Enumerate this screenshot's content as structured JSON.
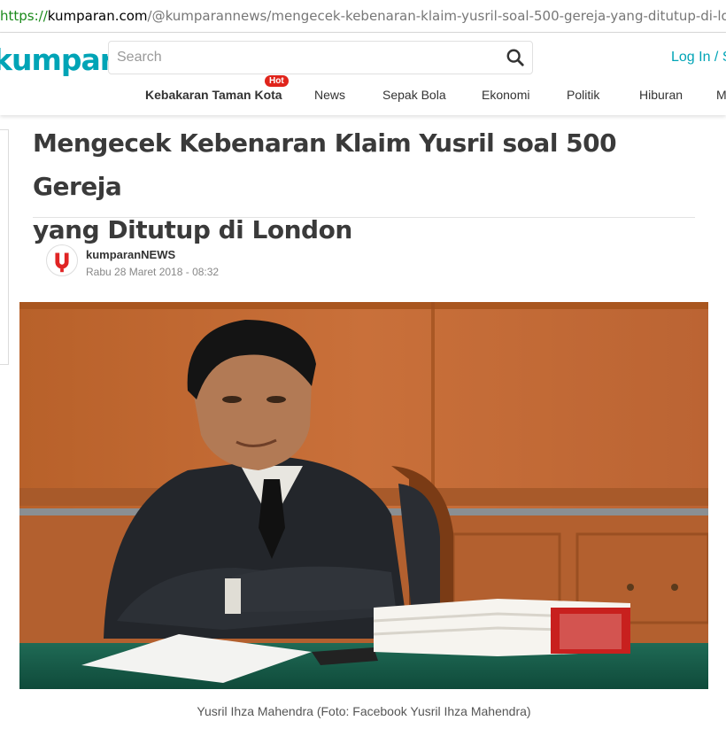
{
  "browser": {
    "url_scheme": "https://",
    "url_host": "kumparan.com",
    "url_path": "/@kumparannews/mengecek-kebenaran-klaim-yusril-soal-500-gereja-yang-ditutup-di-london"
  },
  "header": {
    "logo_text": "kumparan",
    "search_placeholder": "Search",
    "login_text": "Log In / S",
    "nav": [
      {
        "label": "Kebakaran Taman Kota",
        "badge": "Hot"
      },
      {
        "label": "News"
      },
      {
        "label": "Sepak Bola"
      },
      {
        "label": "Ekonomi"
      },
      {
        "label": "Politik"
      },
      {
        "label": "Hiburan"
      },
      {
        "label": "M"
      }
    ]
  },
  "article": {
    "title_line1": "Mengecek Kebenaran Klaim Yusril soal 500 Gereja",
    "title_line2": "yang Ditutup di London",
    "author": "kumparanNEWS",
    "date": "Rabu 28 Maret 2018 - 08:32",
    "caption": "Yusril Ihza Mahendra (Foto: Facebook Yusril Ihza Mahendra)"
  },
  "colors": {
    "brand": "#00a4b6",
    "hot_badge": "#e0241b",
    "avatar_mark": "#e02424"
  }
}
